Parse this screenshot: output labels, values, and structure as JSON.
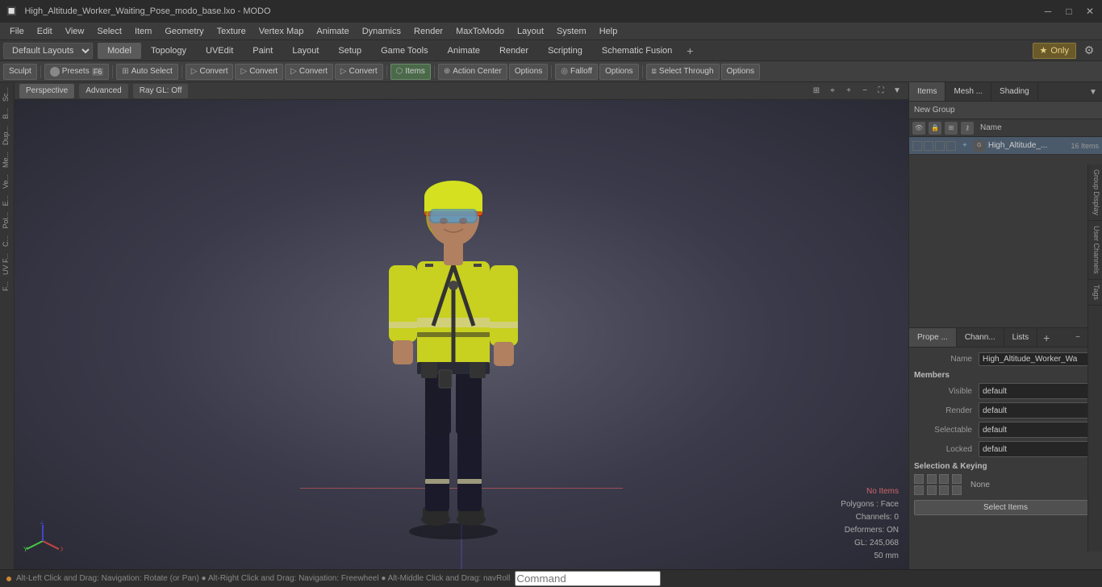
{
  "titlebar": {
    "title": "High_Altitude_Worker_Waiting_Pose_modo_base.lxo - MODO",
    "minimize": "─",
    "maximize": "□",
    "close": "✕"
  },
  "menubar": {
    "items": [
      "File",
      "Edit",
      "View",
      "Select",
      "Item",
      "Geometry",
      "Texture",
      "Vertex Map",
      "Animate",
      "Dynamics",
      "Render",
      "MaxToModo",
      "Layout",
      "System",
      "Help"
    ]
  },
  "layoutbar": {
    "dropdown": "Default Layouts",
    "tabs": [
      "Model",
      "Topology",
      "UVEdit",
      "Paint",
      "Layout",
      "Setup",
      "Game Tools",
      "Animate",
      "Render",
      "Scripting",
      "Schematic Fusion"
    ],
    "active_tab": "Model",
    "only_label": "★ Only",
    "add_icon": "+"
  },
  "toolbar": {
    "sculpt": "Sculpt",
    "presets": "Presets",
    "presets_key": "F6",
    "auto_select": "Auto Select",
    "convert1": "Convert",
    "convert2": "Convert",
    "convert3": "Convert",
    "convert4": "Convert",
    "items": "Items",
    "action_center": "Action Center",
    "options1": "Options",
    "falloff": "Falloff",
    "options2": "Options",
    "select_through": "Select Through",
    "options3": "Options"
  },
  "viewport": {
    "tabs": [
      "Perspective",
      "Advanced",
      "Ray GL: Off"
    ],
    "active_tab": "Perspective",
    "info": {
      "no_items": "No Items",
      "polygons": "Polygons : Face",
      "channels": "Channels: 0",
      "deformers": "Deformers: ON",
      "gl": "GL: 245,068",
      "scale": "50 mm"
    }
  },
  "left_sidebar": {
    "items": [
      "Sc...",
      "B...",
      "Dup...",
      "Me...",
      "Ve...",
      "E...",
      "Pol...",
      "C...",
      "UV F...",
      "F..."
    ]
  },
  "right_panel": {
    "tabs": [
      "Items",
      "Mesh ...",
      "Shading"
    ],
    "new_group": "New Group",
    "header": {
      "name_col": "Name"
    },
    "items_list": [
      {
        "name": "High_Altitude_...",
        "count": "16 Items",
        "selected": true
      }
    ]
  },
  "properties": {
    "tabs": [
      "Prope ...",
      "Chann...",
      "Lists"
    ],
    "add_icon": "+",
    "fields": {
      "name_label": "Name",
      "name_value": "High_Altitude_Worker_Wa",
      "members": "Members",
      "visible_label": "Visible",
      "visible_value": "default",
      "render_label": "Render",
      "render_value": "default",
      "selectable_label": "Selectable",
      "selectable_value": "default",
      "locked_label": "Locked",
      "locked_value": "default",
      "selection_keying": "Selection & Keying",
      "none_label": "None",
      "select_items": "Select Items"
    }
  },
  "right_vtabs": {
    "items": [
      "Group Display",
      "User Channels",
      "Tags"
    ]
  },
  "statusbar": {
    "hint": "Alt-Left Click and Drag: Navigation: Rotate (or Pan) ● Alt-Right Click and Drag: Navigation: Freewheel ● Alt-Middle Click and Drag: navRoll",
    "command_placeholder": "Command"
  }
}
